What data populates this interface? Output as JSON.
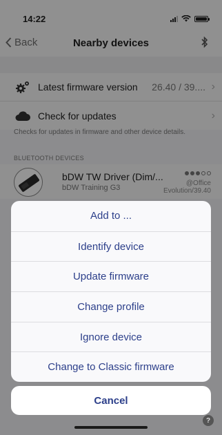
{
  "status_bar": {
    "time": "14:22"
  },
  "nav": {
    "back_label": "Back",
    "title": "Nearby devices"
  },
  "settings": {
    "firmware_label": "Latest firmware version",
    "firmware_value": "26.40 / 39....",
    "updates_label": "Check for updates",
    "note": "Checks for updates in firmware and other device details."
  },
  "devices": {
    "section_title": "BLUETOOTH DEVICES",
    "items": [
      {
        "name": "bDW TW Driver (Dim/...",
        "model": "bDW Training G3",
        "location": "@Office",
        "firmware": "Evolution/39.40",
        "signal_level": 3,
        "signal_max": 5
      }
    ]
  },
  "action_sheet": {
    "actions": [
      "Add to ...",
      "Identify device",
      "Update firmware",
      "Change profile",
      "Ignore device",
      "Change to Classic firmware"
    ],
    "cancel_label": "Cancel"
  },
  "help": {
    "label": "?"
  },
  "colors": {
    "action_text": "#2c3f8a",
    "overlay": "rgba(0,0,0,0.42)"
  }
}
